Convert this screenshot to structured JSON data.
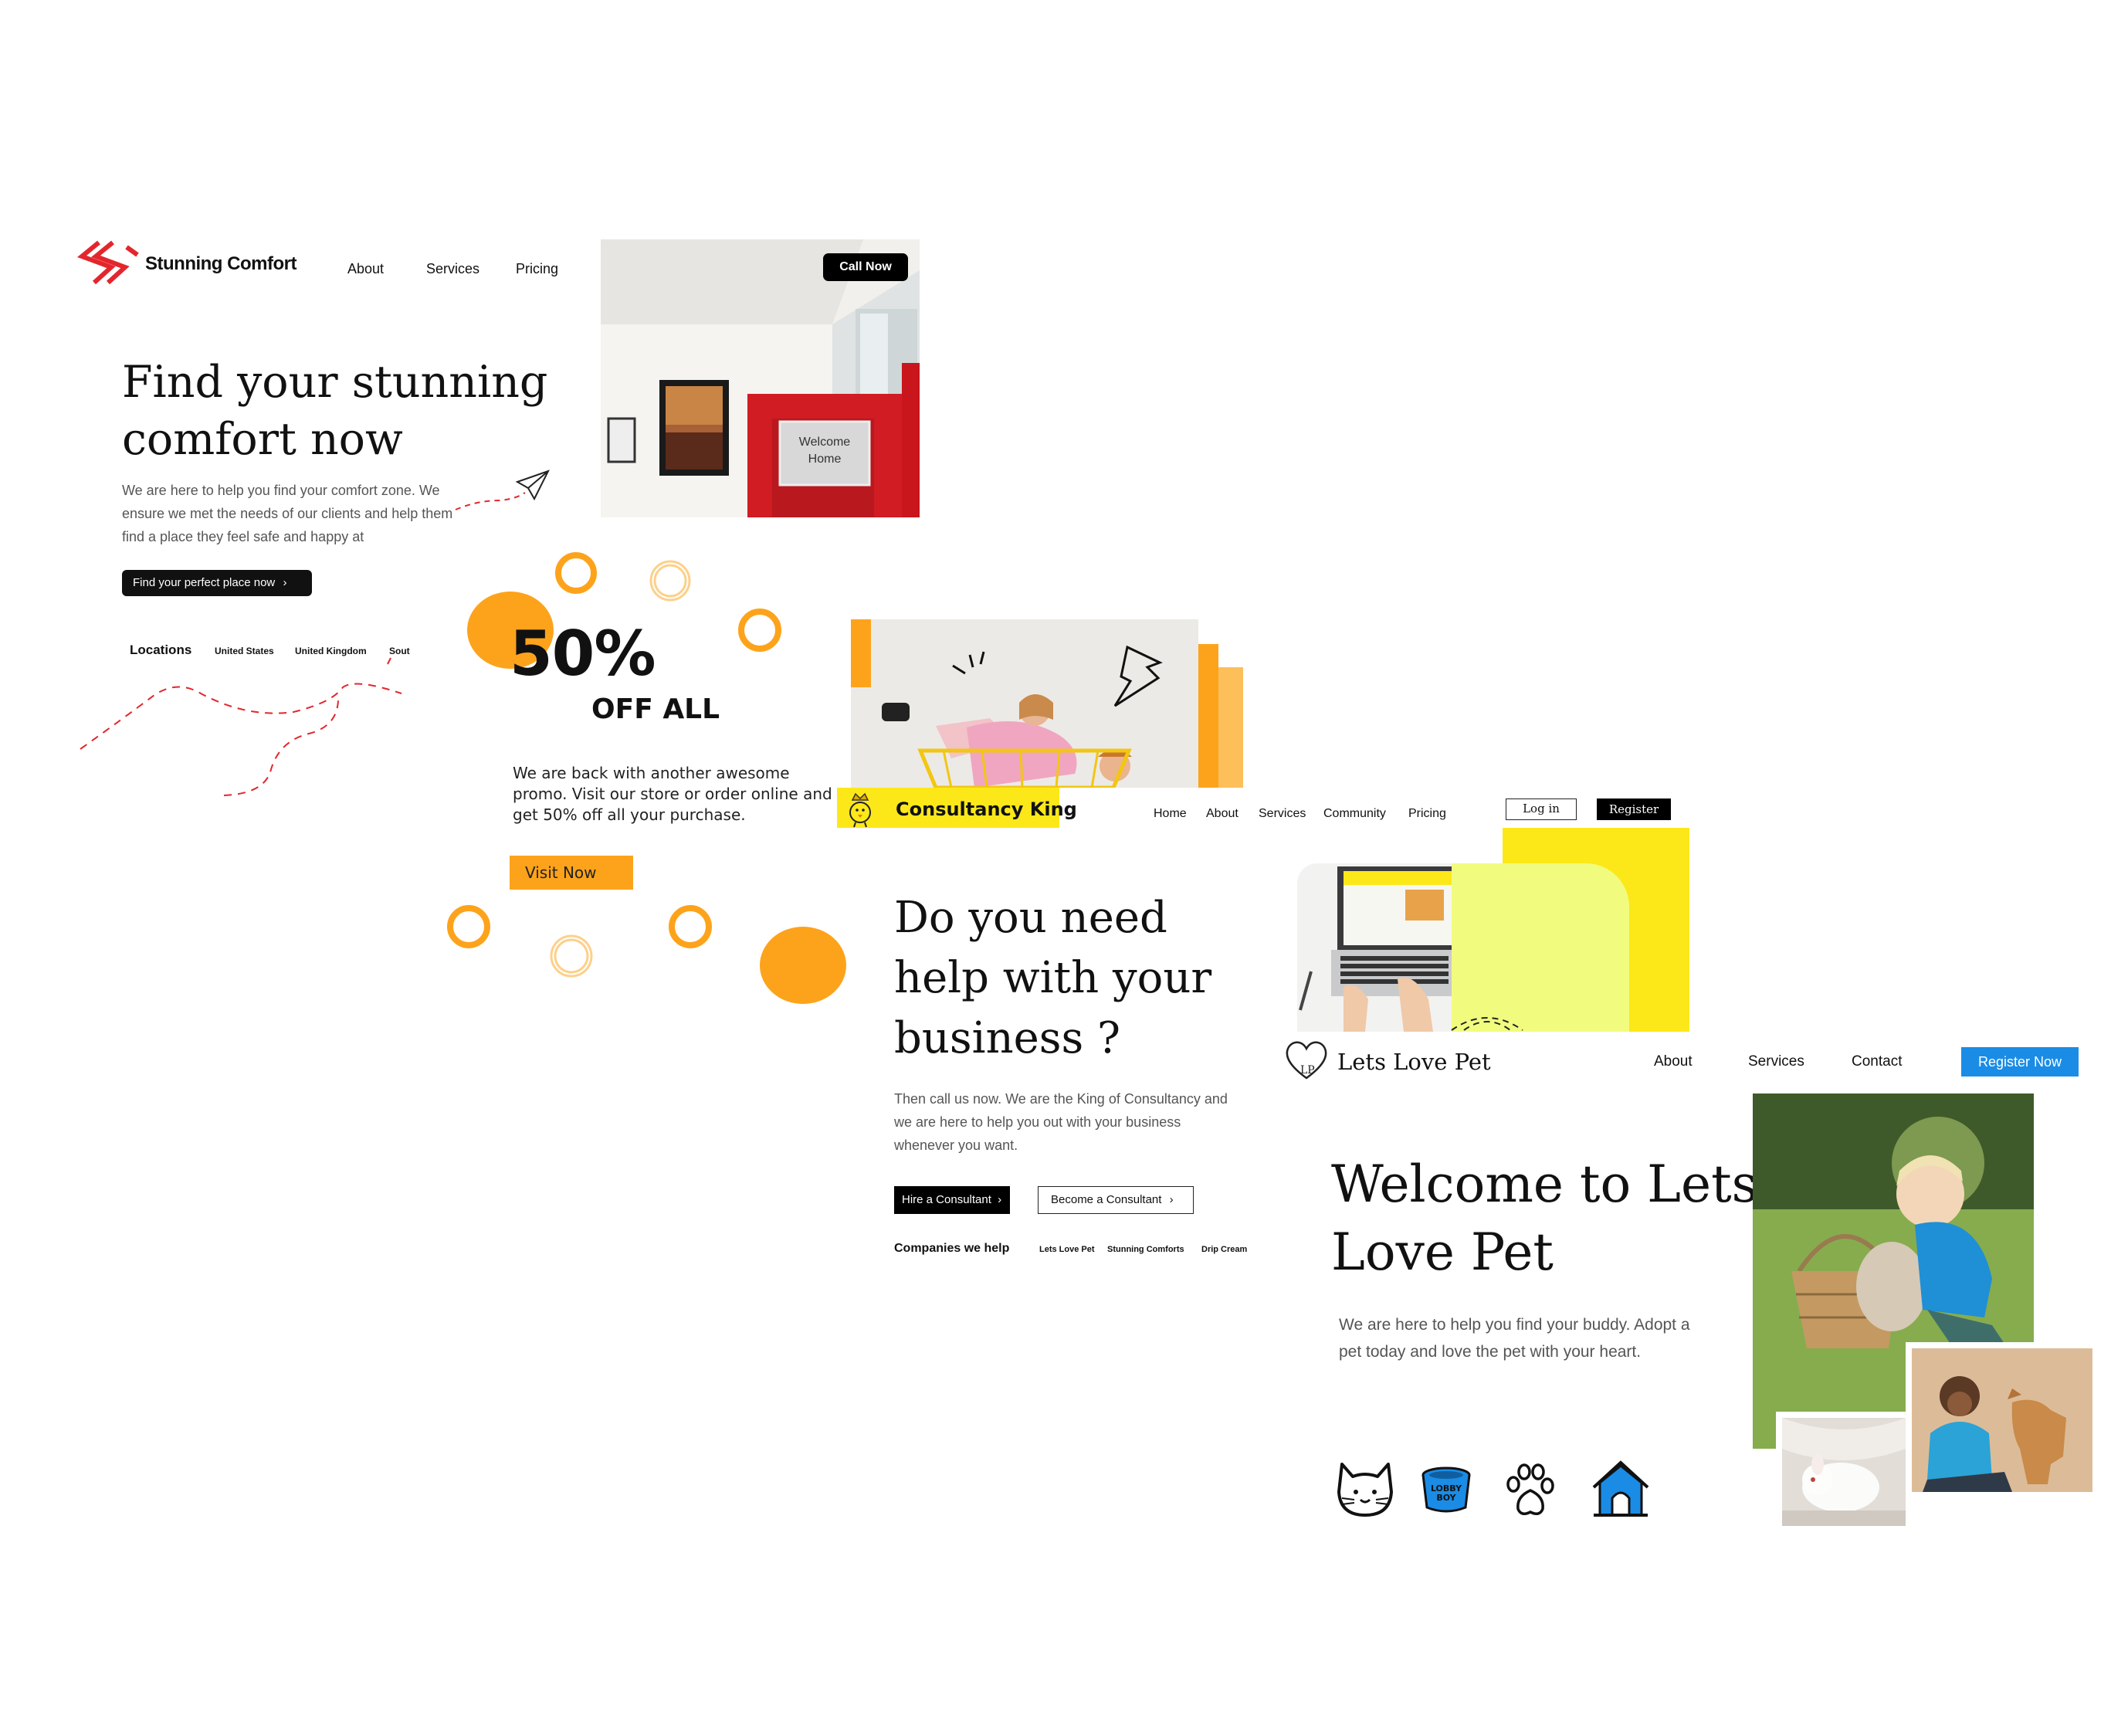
{
  "stunning_comfort": {
    "brand": "Stunning Comfort",
    "nav": [
      "About",
      "Services",
      "Pricing"
    ],
    "call_button": "Call Now",
    "hero_title": "Find your stunning comfort now",
    "description": "We are here to help you find your comfort zone. We ensure we met the needs of our clients and help them find a place they feel safe and happy at",
    "cta_label": "Find your perfect place now",
    "locations_label": "Locations",
    "locations": [
      "United States",
      "United Kingdom",
      "Sout"
    ],
    "photo_sign": "Welcome Home",
    "accent_color": "#e3262d"
  },
  "promo": {
    "discount": "50%",
    "off_label": "OFF ALL",
    "description": "We are back with another awesome promo. Visit our store or order online and get 50% off all your purchase.",
    "button_label": "Visit Now",
    "accent_color": "#fda31b"
  },
  "consultancy_king": {
    "brand": "Consultancy King",
    "nav": [
      "Home",
      "About",
      "Services",
      "Community",
      "Pricing"
    ],
    "login_label": "Log in",
    "register_label": "Register",
    "hero_title": "Do you need help with your business ?",
    "description": "Then call us now. We are the King of Consultancy and we are here to help you out with your business whenever you want.",
    "hire_label": "Hire a Consultant",
    "become_label": "Become a Consultant",
    "companies_label": "Companies we help",
    "companies": [
      "Lets Love Pet",
      "Stunning Comforts",
      "Drip Cream"
    ],
    "accent_color": "#fce819"
  },
  "lets_love_pet": {
    "brand": "Lets Love Pet",
    "nav": [
      "About",
      "Services",
      "Contact"
    ],
    "register_label": "Register Now",
    "hero_title": "Welcome to Lets Love Pet",
    "description": "We are here to help you find your buddy. Adopt a pet today and love the pet with your heart.",
    "bowl_label": "LOBBY BOY",
    "icons": [
      "cat-icon",
      "pet-bowl-icon",
      "paw-icon",
      "dog-house-icon"
    ],
    "accent_color": "#1a8ce6"
  }
}
